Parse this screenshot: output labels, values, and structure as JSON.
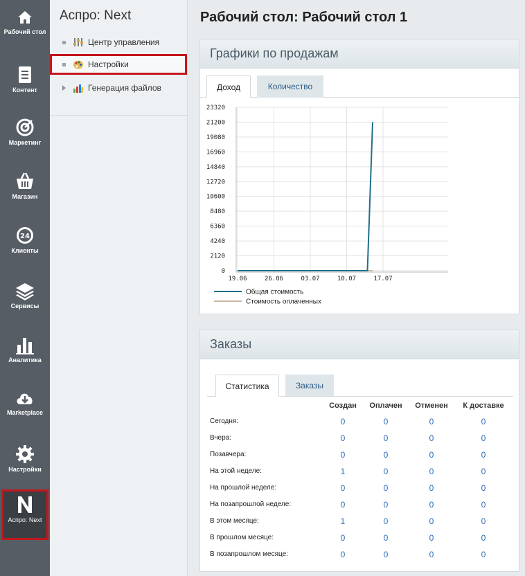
{
  "rail": [
    {
      "label": "Рабочий стол",
      "icon": "home-icon"
    },
    {
      "label": "Контент",
      "icon": "document-icon"
    },
    {
      "label": "Маркетинг",
      "icon": "target-icon"
    },
    {
      "label": "Магазин",
      "icon": "basket-icon"
    },
    {
      "label": "Клиенты",
      "icon": "clients-24-icon"
    },
    {
      "label": "Сервисы",
      "icon": "layers-icon"
    },
    {
      "label": "Аналитика",
      "icon": "bar-chart-icon"
    },
    {
      "label": "Marketplace",
      "icon": "cloud-download-icon"
    },
    {
      "label": "Настройки",
      "icon": "gear-icon"
    },
    {
      "label": "Аспро: Next",
      "icon": "aspro-next-logo-icon"
    }
  ],
  "submenu": {
    "title": "Аспро: Next",
    "items": [
      {
        "label": "Центр управления",
        "icon": "sliders-icon"
      },
      {
        "label": "Настройки",
        "icon": "palette-icon"
      },
      {
        "label": "Генерация файлов",
        "icon": "chart-file-icon"
      }
    ]
  },
  "page_title": "Рабочий стол: Рабочий стол 1",
  "sales_panel": {
    "title": "Графики по продажам",
    "tabs": [
      "Доход",
      "Количество"
    ],
    "active_tab": "Доход"
  },
  "chart_data": {
    "type": "line",
    "x_ticks": [
      "19.06",
      "26.06",
      "03.07",
      "10.07",
      "17.07"
    ],
    "y_ticks": [
      "0",
      "2120",
      "4240",
      "6360",
      "8480",
      "10600",
      "12720",
      "14840",
      "16960",
      "19080",
      "21200",
      "23320"
    ],
    "ylim": [
      0,
      23320
    ],
    "x": [
      "19.06",
      "20.06",
      "21.06",
      "22.06",
      "23.06",
      "24.06",
      "25.06",
      "26.06",
      "27.06",
      "28.06",
      "29.06",
      "30.06",
      "01.07",
      "02.07",
      "03.07",
      "04.07",
      "05.07",
      "06.07",
      "07.07",
      "08.07",
      "09.07",
      "10.07",
      "11.07",
      "12.07",
      "13.07",
      "14.07",
      "15.07"
    ],
    "series": [
      {
        "name": "Общая стоимость",
        "color": "#1f6f8b",
        "values": [
          0,
          0,
          0,
          0,
          0,
          0,
          0,
          0,
          0,
          0,
          0,
          0,
          0,
          0,
          0,
          0,
          0,
          0,
          0,
          0,
          0,
          0,
          0,
          0,
          0,
          0,
          21200
        ]
      },
      {
        "name": "Стоимость оплаченных",
        "color": "#c8b8a4",
        "values": [
          0,
          0,
          0,
          0,
          0,
          0,
          0,
          0,
          0,
          0,
          0,
          0,
          0,
          0,
          0,
          0,
          0,
          0,
          0,
          0,
          0,
          0,
          0,
          0,
          0,
          0,
          0
        ]
      }
    ],
    "grid": true,
    "legend": "bottom-left"
  },
  "orders_panel": {
    "title": "Заказы",
    "tabs": [
      "Статистика",
      "Заказы"
    ],
    "active_tab": "Статистика",
    "columns": [
      "Создан",
      "Оплачен",
      "Отменен",
      "К доставке"
    ],
    "rows": [
      {
        "label": "Сегодня:",
        "values": [
          "0",
          "0",
          "0",
          "0"
        ]
      },
      {
        "label": "Вчера:",
        "values": [
          "0",
          "0",
          "0",
          "0"
        ]
      },
      {
        "label": "Позавчера:",
        "values": [
          "0",
          "0",
          "0",
          "0"
        ]
      },
      {
        "label": "На этой неделе:",
        "values": [
          "1",
          "0",
          "0",
          "0"
        ]
      },
      {
        "label": "На прошлой неделе:",
        "values": [
          "0",
          "0",
          "0",
          "0"
        ]
      },
      {
        "label": "На позапрошлой неделе:",
        "values": [
          "0",
          "0",
          "0",
          "0"
        ]
      },
      {
        "label": "В этом месяце:",
        "values": [
          "1",
          "0",
          "0",
          "0"
        ]
      },
      {
        "label": "В прошлом месяце:",
        "values": [
          "0",
          "0",
          "0",
          "0"
        ]
      },
      {
        "label": "В позапрошлом месяце:",
        "values": [
          "0",
          "0",
          "0",
          "0"
        ]
      }
    ]
  }
}
